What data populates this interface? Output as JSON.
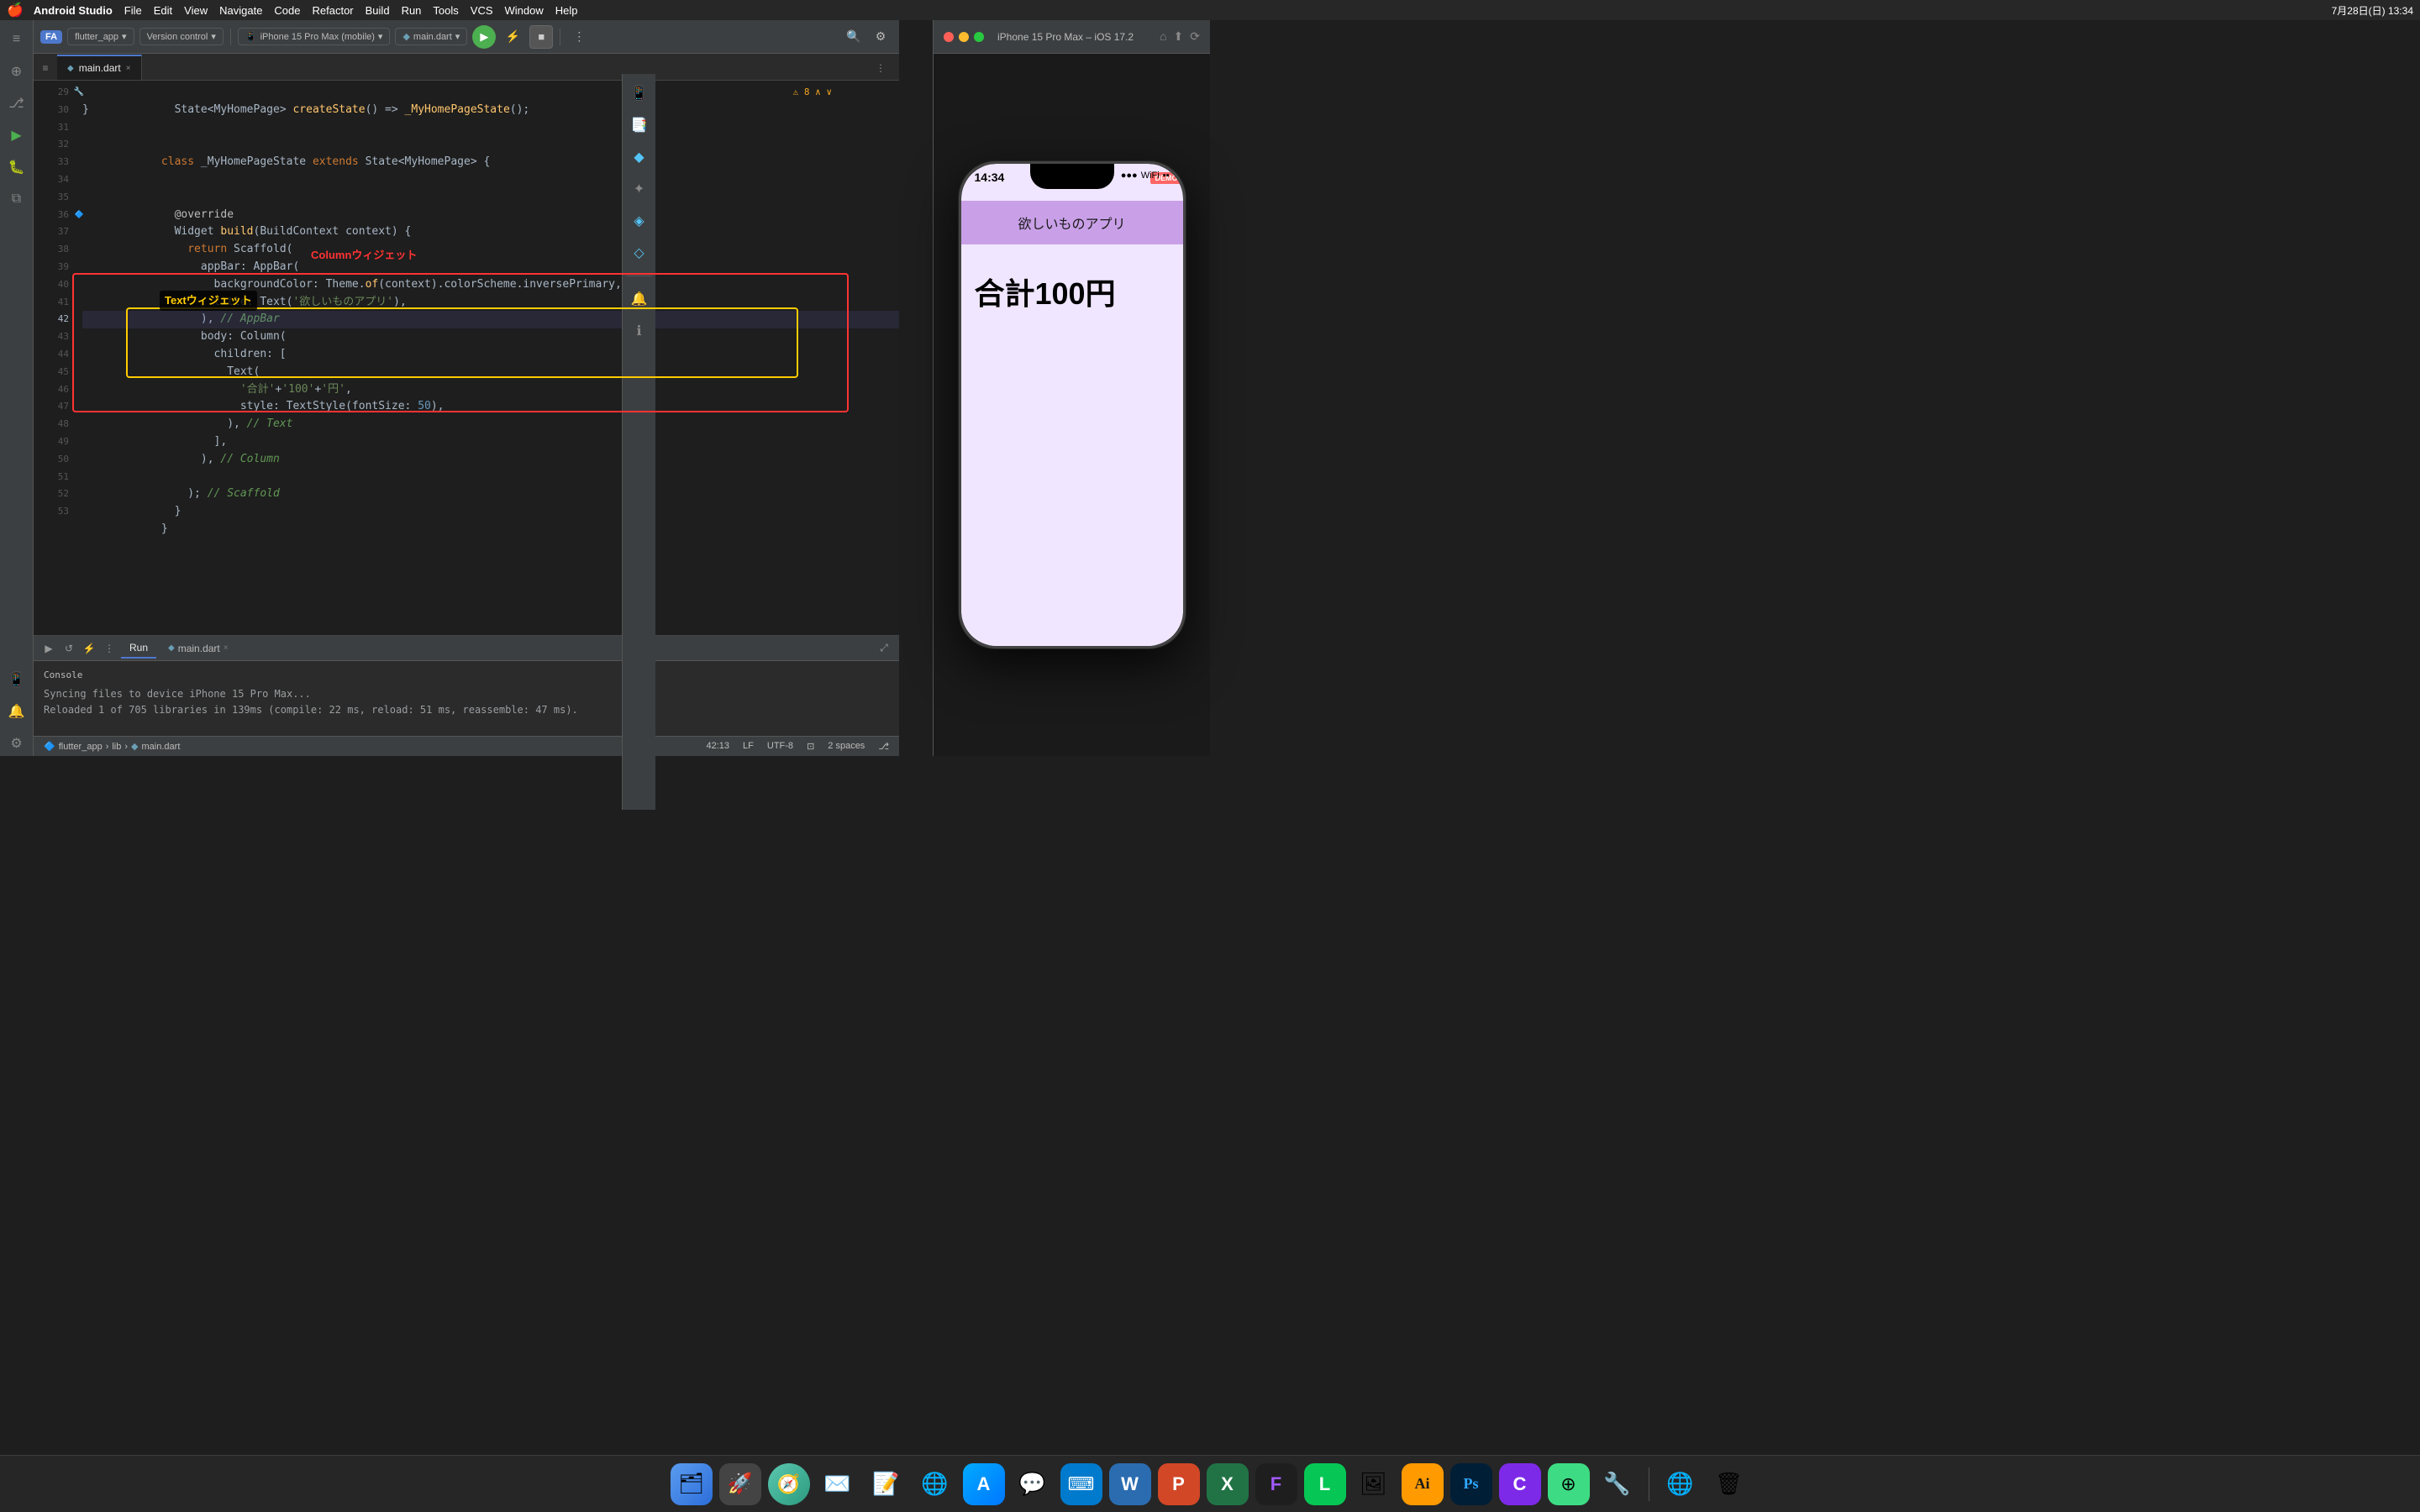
{
  "menubar": {
    "apple": "🍎",
    "app_name": "Android Studio",
    "menus": [
      "File",
      "Edit",
      "View",
      "Navigate",
      "Code",
      "Refactor",
      "Build",
      "Run",
      "Tools",
      "VCS",
      "Window",
      "Help"
    ],
    "time": "7月28日(日) 13:34"
  },
  "toolbar": {
    "project_badge": "FA",
    "project_name": "flutter_app",
    "vcs_label": "Version control",
    "device": "iPhone 15 Pro Max (mobile)",
    "file": "main.dart",
    "run_icon": "▶",
    "stop_icon": "■"
  },
  "file_tab": {
    "name": "main.dart",
    "icon": "◆",
    "close": "×"
  },
  "code": {
    "lines": [
      {
        "num": 29,
        "content": "  State<MyHomePage> createState() => _MyHomePageState();"
      },
      {
        "num": 30,
        "content": "}"
      },
      {
        "num": 31,
        "content": ""
      },
      {
        "num": 32,
        "content": "class _MyHomePageState extends State<MyHomePage> {"
      },
      {
        "num": 33,
        "content": ""
      },
      {
        "num": 34,
        "content": ""
      },
      {
        "num": 35,
        "content": "  @override"
      },
      {
        "num": 36,
        "content": "  Widget build(BuildContext context) {"
      },
      {
        "num": 37,
        "content": "    return Scaffold("
      },
      {
        "num": 38,
        "content": "      appBar: AppBar("
      },
      {
        "num": 39,
        "content": "        backgroundColor: Theme.of(context).colorScheme.inversePrimary,"
      },
      {
        "num": 40,
        "content": "        title: Text('欲しいものアプリ'),"
      },
      {
        "num": 41,
        "content": "      ), // AppBar"
      },
      {
        "num": 42,
        "content": "      body: Column("
      },
      {
        "num": 43,
        "content": "        children: ["
      },
      {
        "num": 44,
        "content": "          Text("
      },
      {
        "num": 45,
        "content": "            '合計'+'100'+'円',"
      },
      {
        "num": 46,
        "content": "            style: TextStyle(fontSize: 50),"
      },
      {
        "num": 47,
        "content": "          ), // Text"
      },
      {
        "num": 48,
        "content": "        ],"
      },
      {
        "num": 49,
        "content": "      ), // Column"
      },
      {
        "num": 50,
        "content": ""
      },
      {
        "num": 51,
        "content": "    ); // Scaffold"
      },
      {
        "num": 52,
        "content": "  }"
      },
      {
        "num": 53,
        "content": "}"
      }
    ]
  },
  "annotations": {
    "column_label": "Columnウィジェット",
    "text_label": "Textウィジェット"
  },
  "bottom_panel": {
    "tab_run": "Run",
    "tab_file": "main.dart",
    "tab_close": "×",
    "console_title": "Console",
    "console_lines": [
      "Syncing files to device iPhone 15 Pro Max...",
      "Reloaded 1 of 705 libraries in 139ms (compile: 22 ms, reload: 51 ms, reassemble: 47 ms)."
    ]
  },
  "status_bar": {
    "project": "flutter_app",
    "lib": "lib",
    "file": "main.dart",
    "position": "42:13",
    "encoding": "LF",
    "charset": "UTF-8",
    "indent": "2 spaces",
    "warnings": "⚠ 8"
  },
  "preview": {
    "title": "iPhone 15 Pro Max – iOS 17.2",
    "time": "14:34",
    "signal": "●●●",
    "wifi": "WiFi",
    "battery": "■■",
    "app_title": "欲しいものアプリ",
    "app_content": "合計100円",
    "demo_badge": "DEMO"
  },
  "dock": {
    "items": [
      {
        "id": "finder",
        "label": "Finder",
        "icon": "🗂",
        "color": "#5b9cf0"
      },
      {
        "id": "launchpad",
        "label": "Launchpad",
        "icon": "🚀",
        "color": "#444"
      },
      {
        "id": "safari",
        "label": "Safari",
        "icon": "🧭",
        "color": "#3a8"
      },
      {
        "id": "notes",
        "label": "Notes",
        "icon": "📝",
        "color": "#ffd"
      },
      {
        "id": "mail",
        "label": "Mail",
        "icon": "✉️",
        "color": "#3af"
      },
      {
        "id": "chrome",
        "label": "Chrome",
        "icon": "🌐",
        "color": "#ea4335"
      },
      {
        "id": "appstore",
        "label": "App Store",
        "icon": "🅐",
        "color": "#0af"
      },
      {
        "id": "slack",
        "label": "Slack",
        "icon": "💬",
        "color": "#611f69"
      },
      {
        "id": "vscode",
        "label": "VS Code",
        "icon": "⌨",
        "color": "#007acc"
      },
      {
        "id": "word",
        "label": "Word",
        "icon": "W",
        "color": "#2b6cb0"
      },
      {
        "id": "ppt",
        "label": "PowerPoint",
        "icon": "P",
        "color": "#d24726"
      },
      {
        "id": "excel",
        "label": "Excel",
        "icon": "X",
        "color": "#217346"
      },
      {
        "id": "figma",
        "label": "Figma",
        "icon": "F",
        "color": "#a259ff"
      },
      {
        "id": "line",
        "label": "LINE",
        "icon": "L",
        "color": "#06c755"
      },
      {
        "id": "preview",
        "label": "Preview",
        "icon": "🖼",
        "color": "#444"
      },
      {
        "id": "illustrator",
        "label": "Illustrator",
        "icon": "Ai",
        "color": "#ff9a00"
      },
      {
        "id": "photoshop",
        "label": "Photoshop",
        "icon": "Ps",
        "color": "#001e36"
      },
      {
        "id": "canva",
        "label": "Canva",
        "icon": "C",
        "color": "#7d2ae8"
      },
      {
        "id": "androidsimulator",
        "label": "Android Simulator",
        "icon": "⊕",
        "color": "#3ddc84"
      },
      {
        "id": "appdev",
        "label": "App Developer",
        "icon": "🔧",
        "color": "#555"
      },
      {
        "id": "network",
        "label": "Network",
        "icon": "🌐",
        "color": "#4a90d9"
      },
      {
        "id": "trash",
        "label": "Trash",
        "icon": "🗑",
        "color": "#aaa"
      }
    ]
  }
}
